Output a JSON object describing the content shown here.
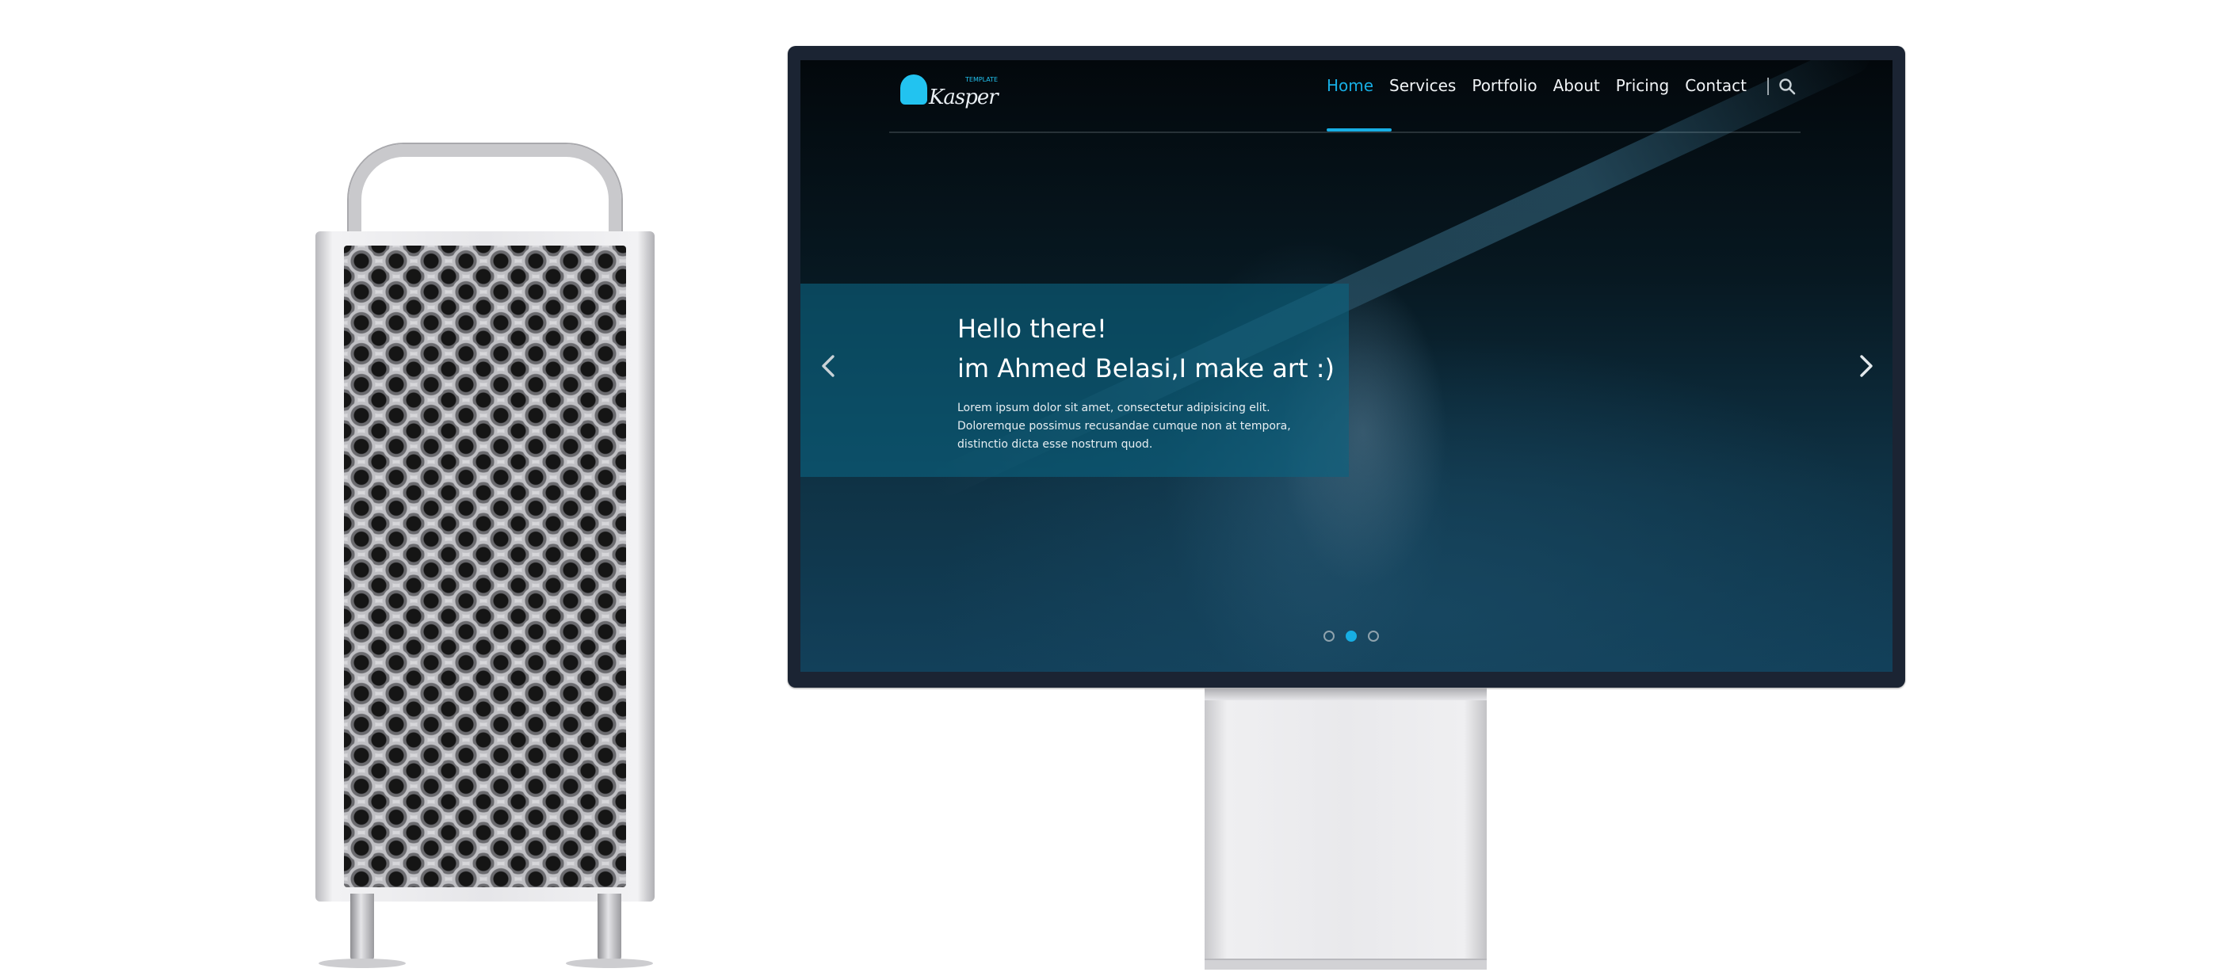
{
  "website": {
    "logo": {
      "text": "Kasper",
      "tagline": "TEMPLATE"
    },
    "nav": {
      "items": [
        "Home",
        "Services",
        "Portfolio",
        "About",
        "Pricing",
        "Contact"
      ],
      "active_index": 0,
      "separator": "|"
    },
    "hero": {
      "title_line1": "Hello there!",
      "title_line2": "im Ahmed Belasi,I make art :)",
      "description": "Lorem ipsum dolor sit amet, consectetur adipisicing elit. Doloremque possimus recusandae cumque non at tempora, distinctio dicta esse nostrum quod."
    },
    "slider": {
      "dot_count": 3,
      "active_dot": 1
    },
    "icons": {
      "prev": "chevron-left-icon",
      "next": "chevron-right-icon",
      "search": "search-icon",
      "logo": "ghost-logo-icon"
    }
  },
  "colors": {
    "accent": "#17aee4",
    "hero_overlay": "#0c6280",
    "monitor_bezel": "#1b2433",
    "nav_text": "#f1f4f6"
  }
}
